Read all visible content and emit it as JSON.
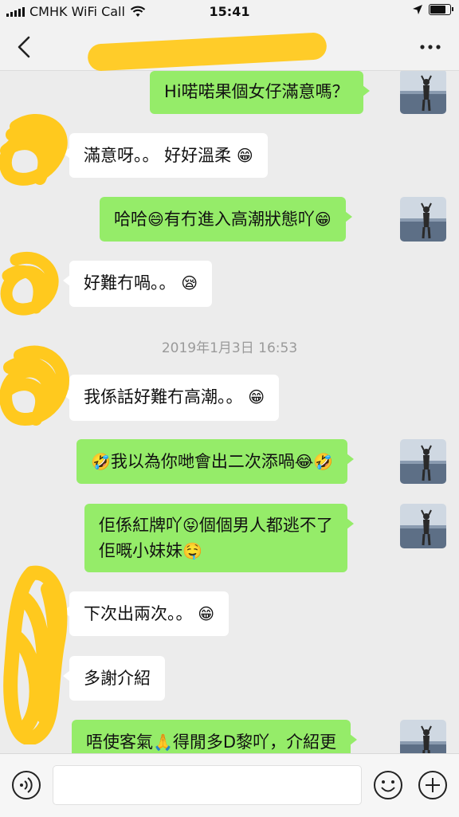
{
  "status_bar": {
    "carrier": "CMHK WiFi Call",
    "time": "15:41",
    "battery_level": 0.85
  },
  "nav": {
    "back_icon": "chevron-left-icon",
    "more_icon": "ellipsis-icon"
  },
  "messages": [
    {
      "side": "out",
      "parts": [
        {
          "text": "Hi喏喏果個女仔滿意嗎？"
        }
      ]
    },
    {
      "side": "in",
      "parts": [
        {
          "text": "滿意呀。。 好好溫柔 "
        },
        {
          "emoji": "😁"
        }
      ]
    },
    {
      "side": "out",
      "parts": [
        {
          "text": "哈哈"
        },
        {
          "emoji": "😄"
        },
        {
          "text": "有冇進入高潮狀態吖"
        },
        {
          "emoji": "😁"
        }
      ]
    },
    {
      "side": "in",
      "parts": [
        {
          "text": "好難冇喎。。 "
        },
        {
          "emoji": "😪"
        }
      ]
    },
    {
      "side": "in",
      "parts": [
        {
          "text": "我係話好難冇高潮。。 "
        },
        {
          "emoji": "😁"
        }
      ]
    },
    {
      "side": "out",
      "parts": [
        {
          "emoji": "🤣"
        },
        {
          "text": "我以為你哋會出二次添喎"
        },
        {
          "emoji": "😂"
        },
        {
          "emoji": "🤣"
        }
      ]
    },
    {
      "side": "out",
      "lines": [
        [
          {
            "text": "佢係紅牌吖"
          },
          {
            "emoji": "😝"
          },
          {
            "text": "個個男人都逃不了"
          }
        ],
        [
          {
            "text": "佢嘅小妹妹"
          },
          {
            "emoji": "🤤"
          }
        ]
      ]
    },
    {
      "side": "in",
      "parts": [
        {
          "text": "下次出兩次。。 "
        },
        {
          "emoji": "😁"
        }
      ]
    },
    {
      "side": "in",
      "parts": [
        {
          "text": "多謝介紹"
        }
      ]
    },
    {
      "side": "out",
      "parts": [
        {
          "text": "唔使客氣"
        },
        {
          "emoji": "🙏"
        },
        {
          "text": "得閒多D黎吖，介紹更"
        }
      ]
    }
  ],
  "timestamp": "2019年1月3日 16:53",
  "input_bar": {
    "voice_icon": "voice-icon",
    "text_value": "",
    "emoji_icon": "emoji-icon",
    "plus_icon": "plus-icon"
  }
}
